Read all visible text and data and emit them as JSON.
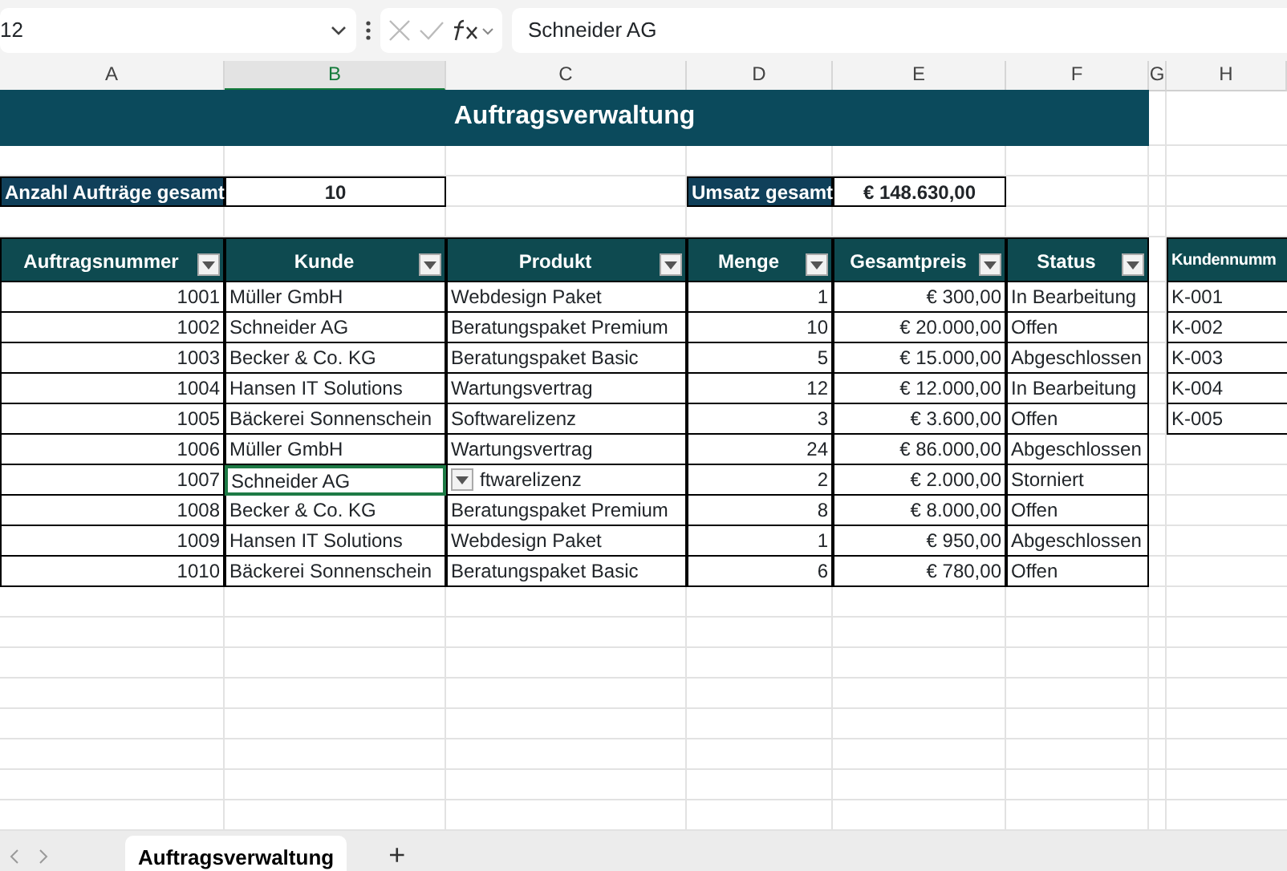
{
  "formula_bar": {
    "name_box": "12",
    "formula": "Schneider AG"
  },
  "columns": [
    {
      "label": "A",
      "selected": false
    },
    {
      "label": "B",
      "selected": true
    },
    {
      "label": "C",
      "selected": false
    },
    {
      "label": "D",
      "selected": false
    },
    {
      "label": "E",
      "selected": false
    },
    {
      "label": "F",
      "selected": false
    },
    {
      "label": "G",
      "selected": false
    },
    {
      "label": "H",
      "selected": false
    }
  ],
  "title": "Auftragsverwaltung",
  "summary": [
    {
      "label": "Anzahl Aufträge gesamt",
      "value": "10"
    },
    {
      "label": "Umsatz gesamt",
      "value": "€ 148.630,00"
    }
  ],
  "table": {
    "columns": [
      "Auftragsnummer",
      "Kunde",
      "Produkt",
      "Menge",
      "Gesamtpreis",
      "Status"
    ],
    "rows": [
      {
        "cells": [
          "1001",
          "Müller GmbH",
          "Webdesign Paket",
          "1",
          "€ 300,00",
          "In Bearbeitung"
        ],
        "selected": false
      },
      {
        "cells": [
          "1002",
          "Schneider AG",
          "Beratungspaket Premium",
          "10",
          "€ 20.000,00",
          "Offen"
        ],
        "selected": false
      },
      {
        "cells": [
          "1003",
          "Becker & Co. KG",
          "Beratungspaket Basic",
          "5",
          "€ 15.000,00",
          "Abgeschlossen"
        ],
        "selected": false
      },
      {
        "cells": [
          "1004",
          "Hansen IT Solutions",
          "Wartungsvertrag",
          "12",
          "€ 12.000,00",
          "In Bearbeitung"
        ],
        "selected": false
      },
      {
        "cells": [
          "1005",
          "Bäckerei Sonnenschein",
          "Softwarelizenz",
          "3",
          "€ 3.600,00",
          "Offen"
        ],
        "selected": false
      },
      {
        "cells": [
          "1006",
          "Müller GmbH",
          "Wartungsvertrag",
          "24",
          "€ 86.000,00",
          "Abgeschlossen"
        ],
        "selected": false
      },
      {
        "cells": [
          "1007",
          "Schneider AG",
          "ftwarelizenz",
          "2",
          "€ 2.000,00",
          "Storniert"
        ],
        "selected": true
      },
      {
        "cells": [
          "1008",
          "Becker & Co. KG",
          "Beratungspaket Premium",
          "8",
          "€ 8.000,00",
          "Offen"
        ],
        "selected": false
      },
      {
        "cells": [
          "1009",
          "Hansen IT Solutions",
          "Webdesign Paket",
          "1",
          "€ 950,00",
          "Abgeschlossen"
        ],
        "selected": false
      },
      {
        "cells": [
          "1010",
          "Bäckerei Sonnenschein",
          "Beratungspaket Basic",
          "6",
          "€ 780,00",
          "Offen"
        ],
        "selected": false
      }
    ]
  },
  "customers": {
    "column": "Kundennumm",
    "rows": [
      "K-001",
      "K-002",
      "K-003",
      "K-004",
      "K-005"
    ]
  },
  "sheet_tabs": [
    {
      "label": "Auftragsverwaltung",
      "selected": true
    }
  ],
  "add_sheet": "+"
}
